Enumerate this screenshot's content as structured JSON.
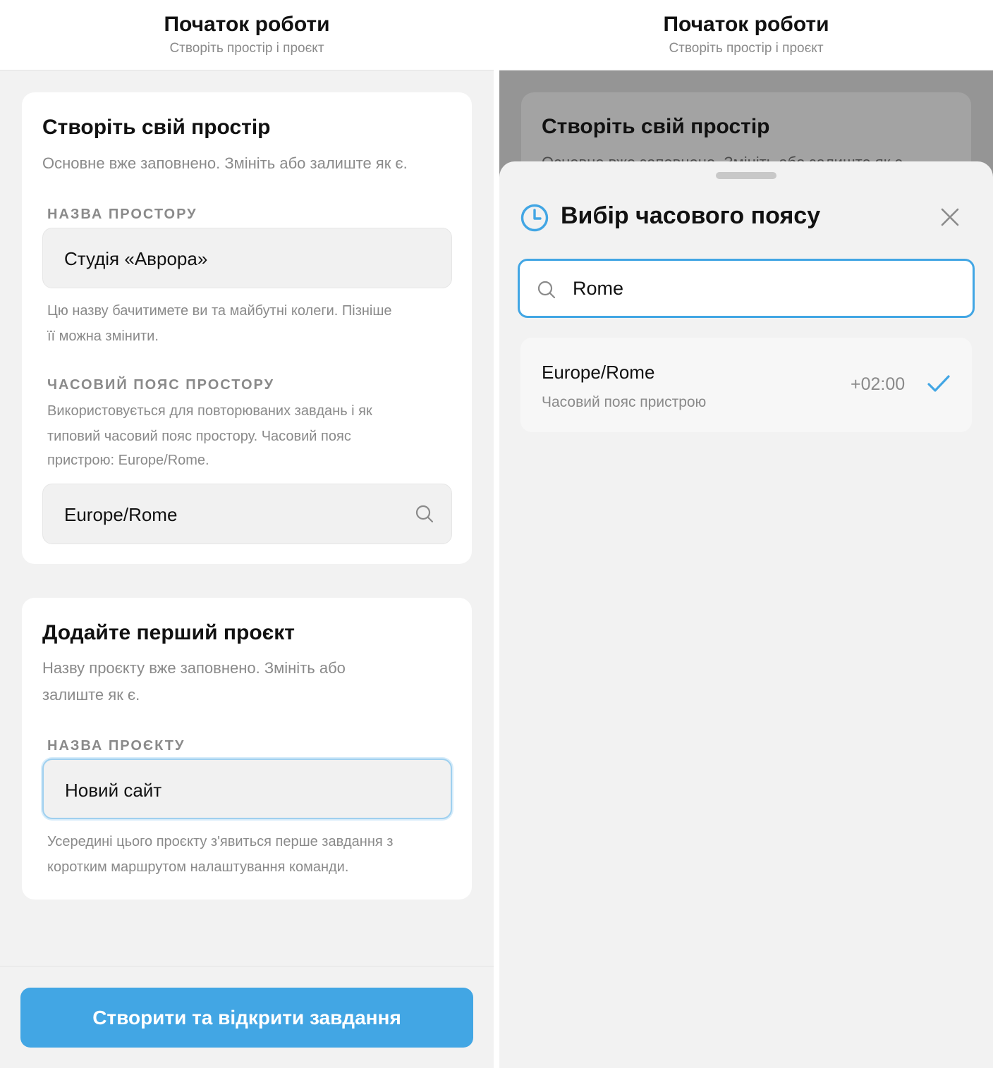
{
  "header": {
    "title": "Початок роботи",
    "subtitle": "Створіть простір і проєкт"
  },
  "workspace_card": {
    "title": "Створіть свій простір",
    "subtitle": "Основне вже заповнено. Змініть або залиште як є.",
    "name_label": "НАЗВА ПРОСТОРУ",
    "name_value": "Студія «Аврора»",
    "name_hint_1": "Цю назву бачитимете ви та майбутні колеги. Пізніше",
    "name_hint_2": "її можна змінити.",
    "tz_label": "ЧАСОВИЙ ПОЯС ПРОСТОРУ",
    "tz_hint_1": "Використовується для повторюваних завдань і як",
    "tz_hint_2": "типовий часовий пояс простору. Часовий пояс",
    "tz_hint_3": "пристрою: Europe/Rome.",
    "tz_value": "Europe/Rome"
  },
  "project_card": {
    "title": "Додайте перший проєкт",
    "subtitle_1": "Назву проєкту вже заповнено. Змініть або",
    "subtitle_2": "залиште як є.",
    "name_label": "НАЗВА ПРОЄКТУ",
    "name_value": "Новий сайт",
    "hint_1": "Усередині цього проєкту з'явиться перше завдання з",
    "hint_2": "коротким маршрутом налаштування команди."
  },
  "cta": {
    "label": "Створити та відкрити завдання"
  },
  "background": {
    "card_title": "Створіть свій простір",
    "card_sub": "Основне вже заповнено. Змініть або залиште як є."
  },
  "timezone_sheet": {
    "title": "Вибір часового поясу",
    "search_value": "Rome",
    "results": [
      {
        "name": "Europe/Rome",
        "note": "Часовий пояс пристрою",
        "offset": "+02:00",
        "selected": true
      }
    ]
  },
  "colors": {
    "accent": "#42a6e4",
    "panel_bg": "#f2f2f2",
    "card_bg": "#ffffff",
    "muted_text": "#8a8a8a",
    "overlay": "#959595"
  },
  "icons": {
    "search": "search-icon",
    "clock": "clock-icon",
    "close": "close-icon",
    "check": "check-icon"
  }
}
